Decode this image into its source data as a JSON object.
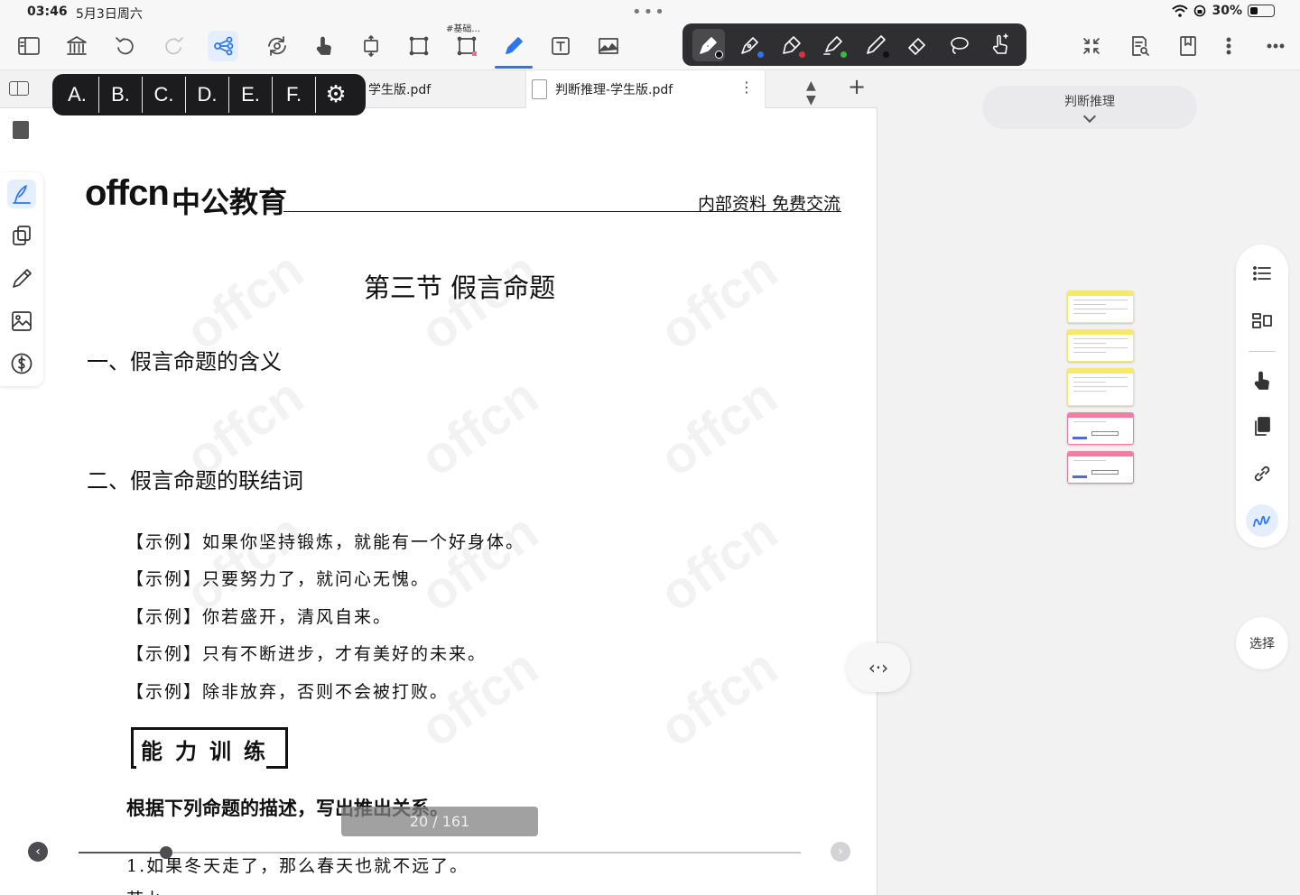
{
  "status_bar": {
    "time": "03:46",
    "date": "5月3日周六",
    "battery": "30%",
    "battery_level": 0.3
  },
  "toolbar": {
    "selection_label": "#基础...",
    "icons": [
      "sidebar-toggle-icon",
      "library-icon",
      "undo-icon",
      "redo-icon",
      "mindmap-icon",
      "sync-icon",
      "hand-icon",
      "scroll-mode-icon",
      "crop-icon",
      "rect-select-icon",
      "pen-icon",
      "text-box-icon",
      "image-icon",
      "collapse-icon",
      "search-doc-icon",
      "bookmark-icon",
      "vertical-more-icon",
      "horizontal-more-icon"
    ],
    "pen_palette": {
      "tools": [
        "fountain-pen",
        "pen",
        "brush-pen",
        "highlighter",
        "pencil",
        "eraser",
        "lasso",
        "touch-draw"
      ],
      "dot_colors": [
        "#111111",
        "#2d74f0",
        "#e0313b",
        "#3bb54a",
        "#111111"
      ]
    }
  },
  "tabs": {
    "items": [
      {
        "label": "学生版.pdf"
      },
      {
        "label": "判断推理-学生版.pdf"
      }
    ],
    "more": "⋮",
    "add": "+"
  },
  "letter_bar": {
    "letters": [
      "A.",
      "B.",
      "C.",
      "D.",
      "E.",
      "F."
    ]
  },
  "document": {
    "brand_latin": "offcn",
    "brand_cn": "中公教育",
    "header_note": "内部资料  免费交流",
    "section_title": "第三节   假言命题",
    "heading_1": "一、假言命题的含义",
    "heading_2": "二、假言命题的联结词",
    "examples": [
      "【示例】如果你坚持锻炼，就能有一个好身体。",
      "【示例】只要努力了，就问心无愧。",
      "【示例】你若盛开，清风自来。",
      "【示例】只有不断进步，才有美好的未来。",
      "【示例】除非放弃，否则不会被打败。"
    ],
    "training_label": "能力训练",
    "prompt": "根据下列命题的描述，写出推出关系。",
    "item_1": "1.如果冬天走了，那么春天也就不远了。",
    "item_2": "若水",
    "watermark": "offcn"
  },
  "pager": {
    "indicator": "20 / 161",
    "current": 20,
    "total": 161
  },
  "divider": {
    "label": "‹·›"
  },
  "right_pane": {
    "outline_title": "判断推理",
    "cards": [
      {
        "color": "#f7e96b"
      },
      {
        "color": "#f7e96b"
      },
      {
        "color": "#f7e96b"
      },
      {
        "color": "#f07ea3"
      },
      {
        "color": "#f07ea3"
      }
    ],
    "select_label": "选择"
  }
}
